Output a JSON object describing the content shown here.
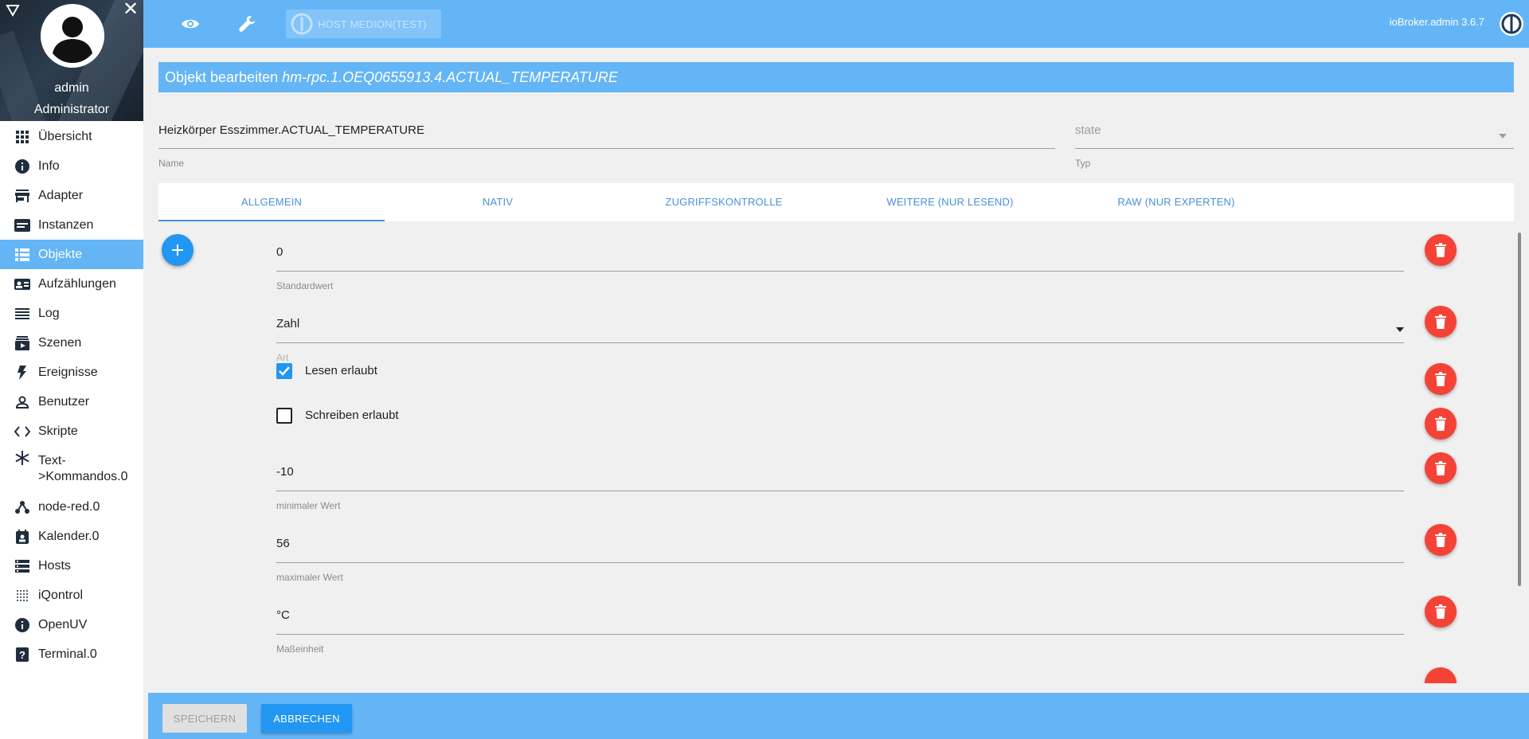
{
  "sidebar": {
    "user_name": "admin",
    "user_role": "Administrator",
    "close_glyph": "✕",
    "items": [
      {
        "label": "Übersicht",
        "icon": "grid-icon"
      },
      {
        "label": "Info",
        "icon": "info-icon"
      },
      {
        "label": "Adapter",
        "icon": "store-icon"
      },
      {
        "label": "Instanzen",
        "icon": "instances-icon"
      },
      {
        "label": "Objekte",
        "icon": "list-icon",
        "active": true
      },
      {
        "label": "Aufzählungen",
        "icon": "enum-icon"
      },
      {
        "label": "Log",
        "icon": "log-icon"
      },
      {
        "label": "Szenen",
        "icon": "scenes-icon"
      },
      {
        "label": "Ereignisse",
        "icon": "flash-icon"
      },
      {
        "label": "Benutzer",
        "icon": "person-icon"
      },
      {
        "label": "Skripte",
        "icon": "code-icon"
      },
      {
        "label": "Text->Kommandos.0",
        "icon": "snowflake-icon"
      },
      {
        "label": "node-red.0",
        "icon": "node-icon"
      },
      {
        "label": "Kalender.0",
        "icon": "calendar-icon"
      },
      {
        "label": "Hosts",
        "icon": "hosts-icon"
      },
      {
        "label": "iQontrol",
        "icon": "dots-grid-icon"
      },
      {
        "label": "OpenUV",
        "icon": "info-icon"
      },
      {
        "label": "Terminal.0",
        "icon": "help-icon"
      }
    ]
  },
  "topbar": {
    "host_label": "HOST MEDION(TEST)",
    "version": "ioBroker.admin 3.6.7"
  },
  "dialog": {
    "title_prefix": "Objekt bearbeiten",
    "object_id": "hm-rpc.1.OEQ0655913.4.ACTUAL_TEMPERATURE",
    "name_value": "Heizkörper Esszimmer.ACTUAL_TEMPERATURE",
    "name_label": "Name",
    "type_value": "state",
    "type_label": "Typ"
  },
  "tabs": [
    {
      "label": "ALLGEMEIN",
      "active": true
    },
    {
      "label": "NATIV"
    },
    {
      "label": "ZUGRIFFSKONTROLLE"
    },
    {
      "label": "WEITERE (NUR LESEND)"
    },
    {
      "label": "RAW (NUR EXPERTEN)"
    }
  ],
  "fields": {
    "default_value": "0",
    "default_label": "Standardwert",
    "type_value": "Zahl",
    "type_label": "Art",
    "read_label": "Lesen erlaubt",
    "read_checked": true,
    "write_label": "Schreiben erlaubt",
    "write_checked": false,
    "min_value": "-10",
    "min_label": "minimaler Wert",
    "max_value": "56",
    "max_label": "maximaler Wert",
    "unit_value": "°C",
    "unit_label": "Maßeinheit"
  },
  "footer": {
    "save_label": "SPEICHERN",
    "cancel_label": "ABBRECHEN"
  },
  "colors": {
    "primary": "#64b5f6",
    "accent": "#2196f3",
    "delete": "#f44336"
  }
}
